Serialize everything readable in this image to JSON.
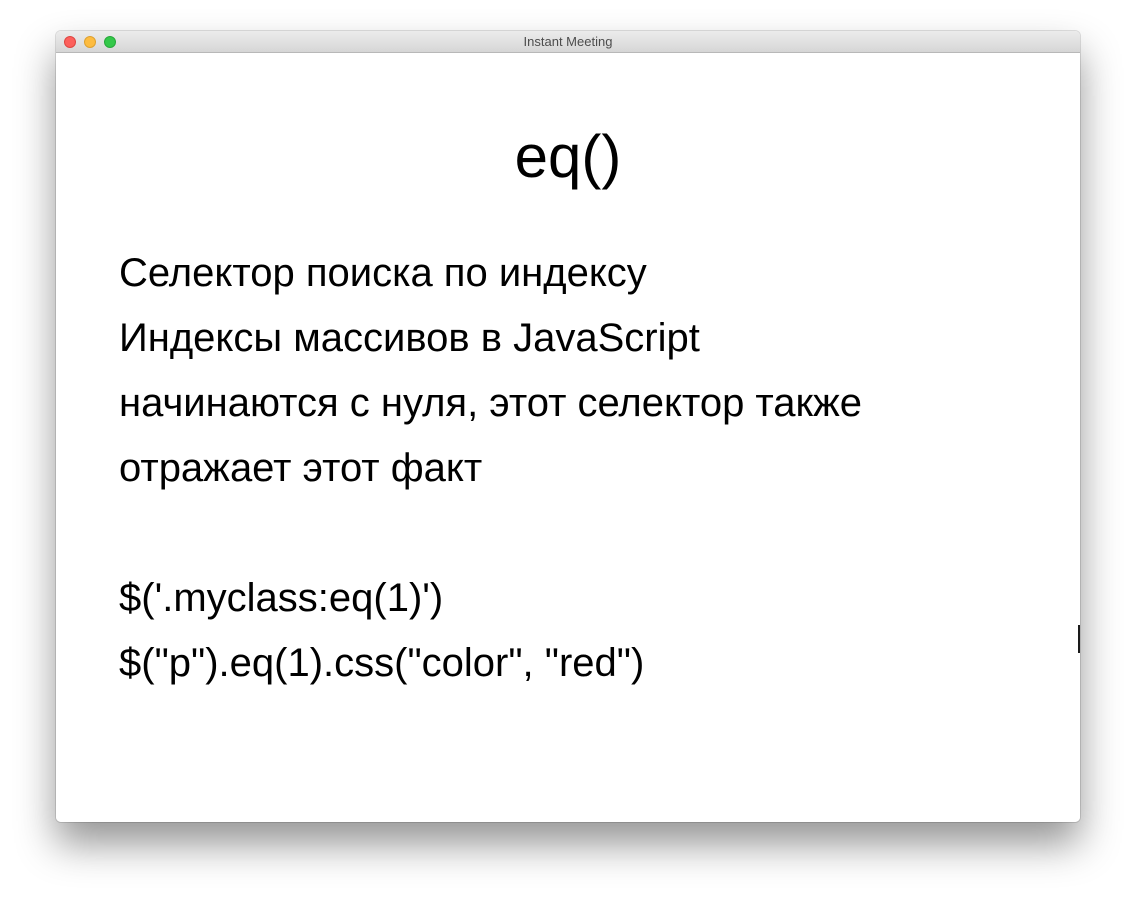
{
  "window": {
    "title": "Instant Meeting"
  },
  "slide": {
    "title": "eq()",
    "lines": [
      "Селектор поиска по индексу",
      "Индексы массивов в JavaScript",
      "начинаются с нуля, этот селектор также",
      "отражает этот факт",
      "",
      "$('.myclass:eq(1)')",
      "$(\"p\").eq(1).css(\"color\", \"red\")"
    ]
  },
  "colors": {
    "close": "#fc605c",
    "minimize": "#fdbc40",
    "zoom": "#34c84a",
    "text": "#000000",
    "background": "#ffffff"
  }
}
